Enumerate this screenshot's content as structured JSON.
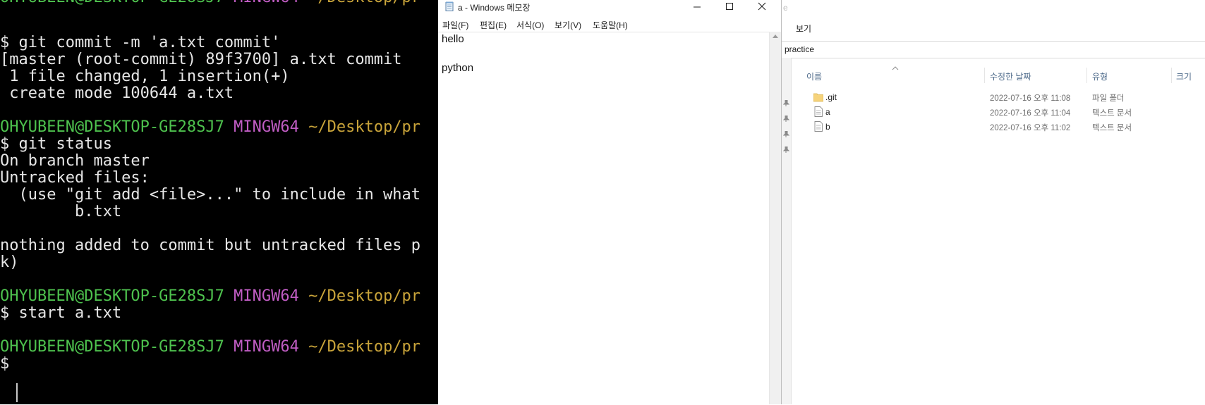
{
  "terminal": {
    "prompt": {
      "user_host": "OHYUBEEN@DESKTOP-GE28SJ7",
      "shell": "MINGW64",
      "path": "~/Desktop/pr"
    },
    "lines": {
      "cmd_commit": "$ git commit -m 'a.txt commit'",
      "commit_result": "[master (root-commit) 89f3700] a.txt commit",
      "changed": " 1 file changed, 1 insertion(+)",
      "create_mode": " create mode 100644 a.txt",
      "cmd_status": "$ git status",
      "on_branch": "On branch master",
      "untracked_header": "Untracked files:",
      "use_hint": "  (use \"git add <file>...\" to include in what",
      "untracked_file": "        b.txt",
      "nothing_added": "nothing added to commit but untracked files p",
      "nothing_added_cont": "k)",
      "cmd_start": "$ start a.txt",
      "empty_prompt": "$"
    }
  },
  "notepad": {
    "title": "a - Windows 메모장",
    "menus": [
      "파일(F)",
      "편집(E)",
      "서식(O)",
      "보기(V)",
      "도움말(H)"
    ],
    "content": "hello\n\npython"
  },
  "explorer": {
    "ribbon_peek": "e",
    "view_tab": "보기",
    "path": "practice",
    "columns": {
      "name": "이름",
      "date": "수정한 날짜",
      "type": "유형",
      "size": "크기"
    },
    "files": [
      {
        "name": ".git",
        "date": "2022-07-16 오후 11:08",
        "type": "파일 폴더",
        "icon": "folder-icon"
      },
      {
        "name": "a",
        "date": "2022-07-16 오후 11:04",
        "type": "텍스트 문서",
        "icon": "text-file-icon"
      },
      {
        "name": "b",
        "date": "2022-07-16 오후 11:02",
        "type": "텍스트 문서",
        "icon": "text-file-icon"
      }
    ]
  },
  "colors": {
    "terminal_bg": "#000000",
    "terminal_text": "#e6e6e6",
    "prompt_user": "#4ec24e",
    "prompt_shell": "#c15dc4",
    "prompt_path": "#c9a43a",
    "untracked": "#e0403f",
    "explorer_header": "#4d6a8a"
  }
}
